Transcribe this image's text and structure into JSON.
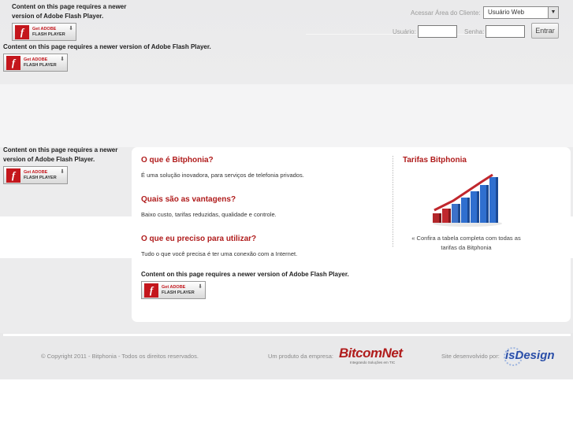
{
  "flash": {
    "message": "Content on this page requires a newer version of Adobe Flash Player.",
    "badge_get": "Get ADOBE",
    "badge_product": "FLASH PLAYER"
  },
  "login": {
    "client_area_label": "Acessar Área do Cliente:",
    "client_select_value": "Usuário Web",
    "user_label": "Usuário:",
    "user_value": "",
    "password_label": "Senha:",
    "password_value": "",
    "submit_label": "Entrar"
  },
  "main": {
    "sections": [
      {
        "title": "O que é Bitphonia?",
        "text": "É uma solução inovadora, para serviços de telefonia privados."
      },
      {
        "title": "Quais são as vantagens?",
        "text": "Baixo custo, tarifas reduzidas, qualidade e controle."
      },
      {
        "title": "O que eu preciso para utilizar?",
        "text": "Tudo o que você precisa é ter uma conexão com a Internet."
      }
    ],
    "rates": {
      "title": "Tarifas Bitphonia",
      "caption": "« Confira a tabela completa com todas as tarifas da Bitphonia"
    }
  },
  "footer": {
    "copyright": "© Copyright 2011 - Bitphonia - Todos os direitos reservados.",
    "product_label": "Um produto da empresa:",
    "company_logo": "BitcomNet",
    "company_tagline": "Integrando Soluções em TIC",
    "developer_label": "Site desenvolvido por:",
    "developer_logo": "isDesign"
  },
  "colors": {
    "heading_red": "#b01c1c",
    "flash_red": "#c4161c",
    "chart_blue": "#2f6fcf",
    "chart_red": "#c0272d"
  },
  "icons": [
    "flash-player-icon",
    "download-arrow-icon",
    "dropdown-caret-icon",
    "bar-chart-illustration"
  ]
}
